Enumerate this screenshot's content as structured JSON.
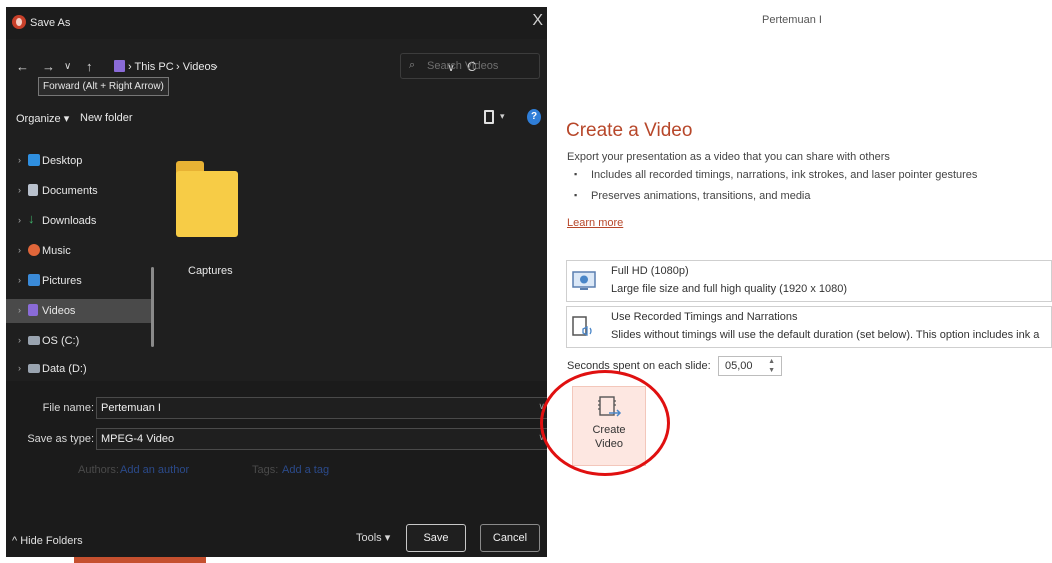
{
  "dialog": {
    "title": "Save As",
    "close_label": "X",
    "nav": {
      "back": "←",
      "forward": "→",
      "recent": "∨",
      "up": "↑",
      "tooltip": "Forward (Alt + Right Arrow)"
    },
    "address": {
      "crumbs": [
        "› This PC",
        "› Videos",
        "›"
      ],
      "dropdown": "∨",
      "refresh": "C"
    },
    "search": {
      "placeholder": "Search Videos"
    },
    "toolbar": {
      "organize": "Organize ▾",
      "new_folder": "New folder",
      "view_dd": "▾",
      "help": "?"
    },
    "sidebar": {
      "items": [
        {
          "label": "Desktop",
          "icon": "desktop-icon",
          "color": "#2f8fe0"
        },
        {
          "label": "Documents",
          "icon": "documents-icon",
          "color": "#b8c0cc"
        },
        {
          "label": "Downloads",
          "icon": "downloads-icon",
          "color": "#3fb26a"
        },
        {
          "label": "Music",
          "icon": "music-icon",
          "color": "#e0663a"
        },
        {
          "label": "Pictures",
          "icon": "pictures-icon",
          "color": "#3a8ad8"
        },
        {
          "label": "Videos",
          "icon": "videos-icon",
          "color": "#8a6bd8"
        },
        {
          "label": "OS (C:)",
          "icon": "drive-icon",
          "color": "#9aa4b0"
        },
        {
          "label": "Data (D:)",
          "icon": "drive-icon",
          "color": "#9aa4b0"
        }
      ],
      "selected": "Videos"
    },
    "folder": {
      "label": "Captures"
    },
    "file_name": {
      "label": "File name:",
      "value": "Pertemuan I"
    },
    "save_as_type": {
      "label": "Save as type:",
      "value": "MPEG-4 Video"
    },
    "authors": {
      "label": "Authors:",
      "value": "Add an author"
    },
    "tags": {
      "label": "Tags:",
      "value": "Add a tag"
    },
    "hide_folders": "^ Hide Folders",
    "tools": "Tools ▾",
    "save_button": "Save",
    "cancel_button": "Cancel"
  },
  "powerpoint": {
    "doc_title": "Pertemuan I",
    "heading": "Create a Video",
    "description": "Export your presentation as a video that you can share with others",
    "bullets": [
      "Includes all recorded timings, narrations, ink strokes, and laser pointer gestures",
      "Preserves animations, transitions, and media"
    ],
    "learn_more": "Learn more",
    "quality": {
      "title": "Full HD (1080p)",
      "subtitle": "Large file size and full high quality (1920 x 1080)"
    },
    "timings": {
      "title": "Use Recorded Timings and Narrations",
      "subtitle": "Slides without timings will use the default duration (set below). This option includes ink a"
    },
    "seconds": {
      "label": "Seconds spent on each slide:",
      "value": "05,00"
    },
    "create_button": "Create\nVideo",
    "accent_color": "#b7472a",
    "highlight_color": "#e01010"
  }
}
